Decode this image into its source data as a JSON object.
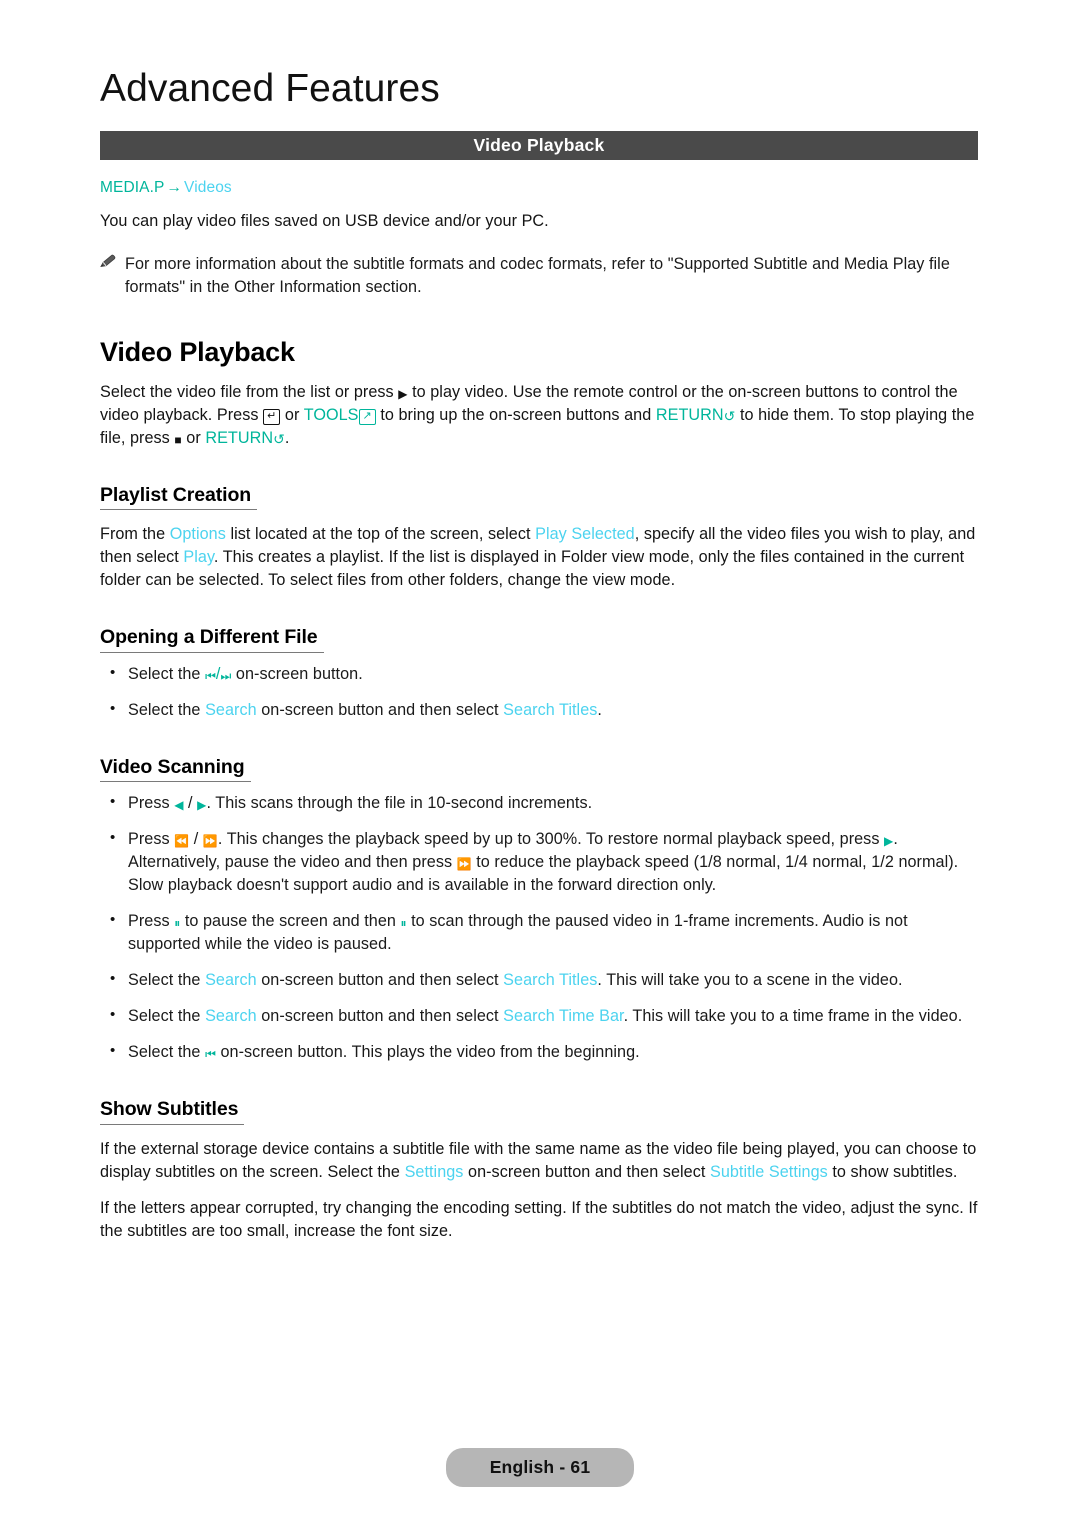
{
  "chapter": {
    "title": "Advanced Features"
  },
  "section_bar": {
    "title": "Video Playback"
  },
  "breadcrumb": {
    "root": "MEDIA.P",
    "arrow": "→",
    "leaf": "Videos"
  },
  "intro": {
    "paragraph": "You can play video files saved on USB device and/or your PC."
  },
  "note": {
    "icon": "pencil-note-icon",
    "text": "For more information about the subtitle formats and codec formats, refer to \"Supported Subtitle and Media Play file formats\" in the Other Information section."
  },
  "main_heading": "Video Playback",
  "main_paragraph": {
    "p1": "Select the video file from the list or press",
    "icon_play": "▶",
    "p2": "to play video. Use the remote control or the on-screen buttons to control the video playback. Press",
    "icon_enter": "↵",
    "p3": "or",
    "tools_label": "TOOLS",
    "icon_tools": "↗",
    "p4": "to bring up the on-screen buttons and",
    "return_label_1": "RETURN",
    "icon_return_1": "↺",
    "p5": "to hide them. To stop playing the file, press",
    "icon_stop": "■",
    "p6": "or",
    "return_label_2": "RETURN",
    "icon_return_2": "↺",
    "p7": "."
  },
  "sections": [
    {
      "id": "playlist-creation",
      "heading": "Playlist Creation",
      "paragraph": {
        "t1": "From the",
        "link1": "Options",
        "t2": "list located at the top of the screen, select",
        "link2": "Play Selected",
        "t3": ", specify all the video files you wish to play, and then select",
        "link3": "Play",
        "t4": ". This creates a playlist. If the list is displayed in Folder view mode, only the files contained in the current folder can be selected. To select files from other folders, change the view mode."
      }
    },
    {
      "id": "opening-a-different-file",
      "heading": "Opening a Different File",
      "bullets": [
        {
          "t1": "Select the",
          "icon_prev": "⏮",
          "slash": "/",
          "icon_next": "⏭",
          "t2": "on-screen button."
        },
        {
          "t1": "Select the",
          "link1": "Search",
          "t2": "on-screen button and then select",
          "link2": "Search Titles",
          "t3": "."
        }
      ]
    },
    {
      "id": "video-scanning",
      "heading": "Video Scanning",
      "bullets": [
        {
          "t1": "Press",
          "icon_left": "◀",
          "slash": "/",
          "icon_right": "▶",
          "t2": ". This scans through the file in 10-second increments."
        },
        {
          "t1": "Press",
          "icon_rew": "⏪",
          "slash": "/",
          "icon_ff": "⏩",
          "t2": ". This changes the playback speed by up to 300%. To restore normal playback speed, press",
          "icon_play": "▶",
          "t3": ". Alternatively, pause the video and then press",
          "icon_ff2": "⏩",
          "t4": "to reduce the playback speed (1/8 normal, 1/4 normal, 1/2 normal). Slow playback doesn't support audio and is available in the forward direction only."
        },
        {
          "t1": "Press",
          "icon_pause1": "⏸",
          "t2": "to pause the screen and then",
          "icon_pause2": "⏸",
          "t3": "to scan through the paused video in 1-frame increments. Audio is not supported while the video is paused."
        },
        {
          "t1": "Select the",
          "link1": "Search",
          "t2": "on-screen button and then select",
          "link2": "Search Titles",
          "t3": ". This will take you to a scene in the video."
        },
        {
          "t1": "Select the",
          "link1": "Search",
          "t2": "on-screen button and then select",
          "link2": "Search Time Bar",
          "t3": ". This will take you to a time frame in the video."
        },
        {
          "t1": "Select the",
          "icon_prev": "⏮",
          "t2": "on-screen button. This plays the video from the beginning."
        }
      ]
    },
    {
      "id": "show-subtitles",
      "heading": "Show Subtitles",
      "paragraph1": {
        "t1": "If the external storage device contains a subtitle file with the same name as the video file being played, you can choose to display subtitles on the screen. Select the",
        "link1": "Settings",
        "t2": "on-screen button and then select",
        "link2": "Subtitle Settings",
        "t3": "to show subtitles."
      },
      "paragraph2": "If the letters appear corrupted, try changing the encoding setting. If the subtitles do not match the video, adjust the sync. If the subtitles are too small, increase the font size."
    }
  ],
  "footer": {
    "page_label": "English - 61"
  },
  "colors": {
    "teal": "#00b59b",
    "cyan": "#4cd3ef",
    "bar_bg": "#4a4a4a",
    "pill_bg": "#b6b6b6"
  }
}
